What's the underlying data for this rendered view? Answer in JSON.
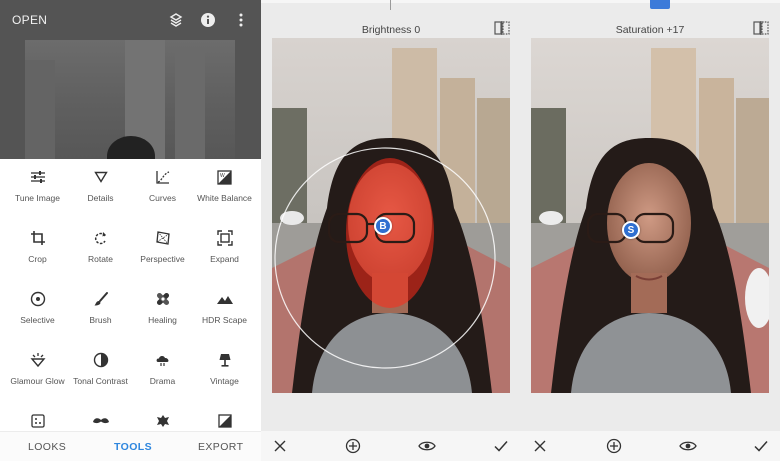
{
  "app": {
    "open_label": "OPEN"
  },
  "tools": [
    {
      "label": "Tune Image",
      "icon": "tune-icon"
    },
    {
      "label": "Details",
      "icon": "details-triangle-icon"
    },
    {
      "label": "Curves",
      "icon": "curves-icon"
    },
    {
      "label": "White Balance",
      "icon": "white-balance-icon"
    },
    {
      "label": "Crop",
      "icon": "crop-icon"
    },
    {
      "label": "Rotate",
      "icon": "rotate-icon"
    },
    {
      "label": "Perspective",
      "icon": "perspective-icon"
    },
    {
      "label": "Expand",
      "icon": "expand-icon"
    },
    {
      "label": "Selective",
      "icon": "selective-icon"
    },
    {
      "label": "Brush",
      "icon": "brush-icon"
    },
    {
      "label": "Healing",
      "icon": "healing-icon"
    },
    {
      "label": "HDR Scape",
      "icon": "hdr-mountain-icon"
    },
    {
      "label": "Glamour Glow",
      "icon": "glamour-glow-icon"
    },
    {
      "label": "Tonal Contrast",
      "icon": "tonal-contrast-icon"
    },
    {
      "label": "Drama",
      "icon": "drama-cloud-icon"
    },
    {
      "label": "Vintage",
      "icon": "vintage-lamp-icon"
    }
  ],
  "bottom_tabs": {
    "looks": "LOOKS",
    "tools": "TOOLS",
    "export": "EXPORT",
    "active": "TOOLS"
  },
  "panes": [
    {
      "title": "Brightness 0",
      "pin_letter": "B",
      "selection_overlay": "red"
    },
    {
      "title": "Saturation +17",
      "pin_letter": "S",
      "selection_overlay": "none"
    }
  ],
  "colors": {
    "accent": "#2e86de",
    "pin": "#2f6fd0",
    "selection_overlay": "#ff2a1a"
  }
}
